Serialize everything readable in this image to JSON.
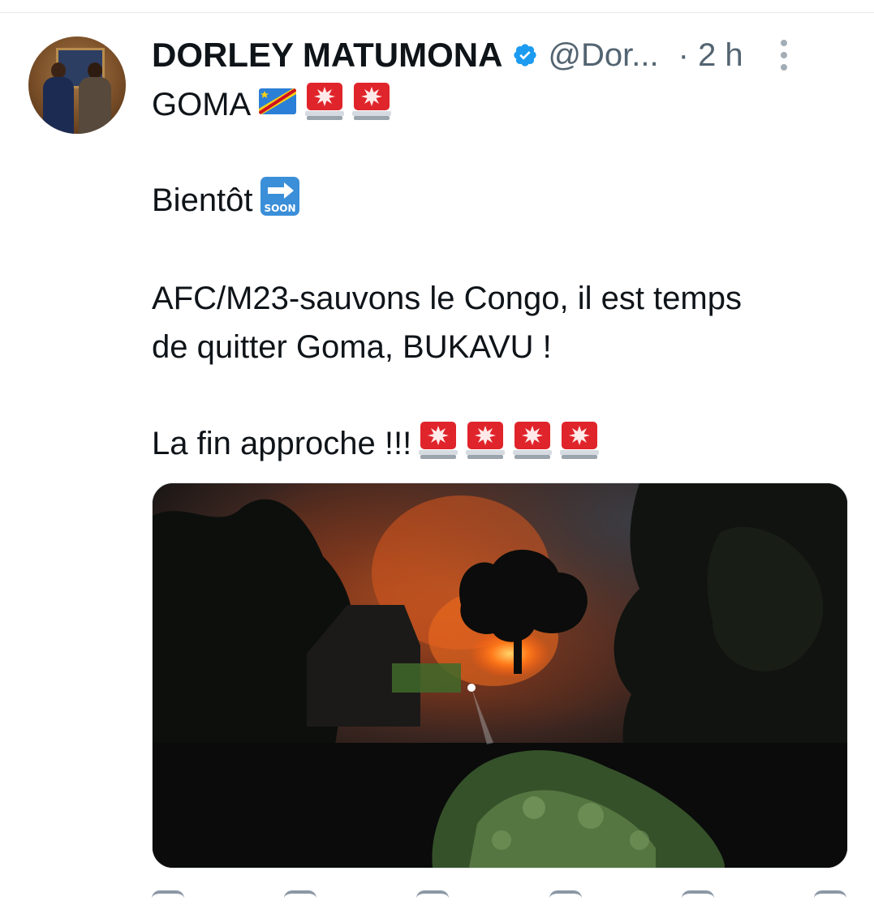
{
  "tweet": {
    "author_name": "DORLEY MATUMONA",
    "handle": "@Dor...",
    "time": "· 2 h",
    "verified": true,
    "lines": {
      "line1": "GOMA",
      "line2": "Bientôt",
      "line3": "AFC/M23-sauvons le Congo, il est temps",
      "line4": "de quitter Goma, BUKAVU !",
      "line5": "La fin approche !!!"
    },
    "emojis": {
      "line1": [
        "drc-flag-icon",
        "police-light-icon",
        "police-light-icon"
      ],
      "line2": [
        "soon-arrow-icon"
      ],
      "line5": [
        "police-light-icon",
        "police-light-icon",
        "police-light-icon",
        "police-light-icon"
      ]
    },
    "soon_label": "SOON"
  },
  "colors": {
    "text": "#0f1419",
    "secondary": "#536471",
    "verified_blue": "#1d9bf0",
    "siren_red": "#e0242b"
  }
}
